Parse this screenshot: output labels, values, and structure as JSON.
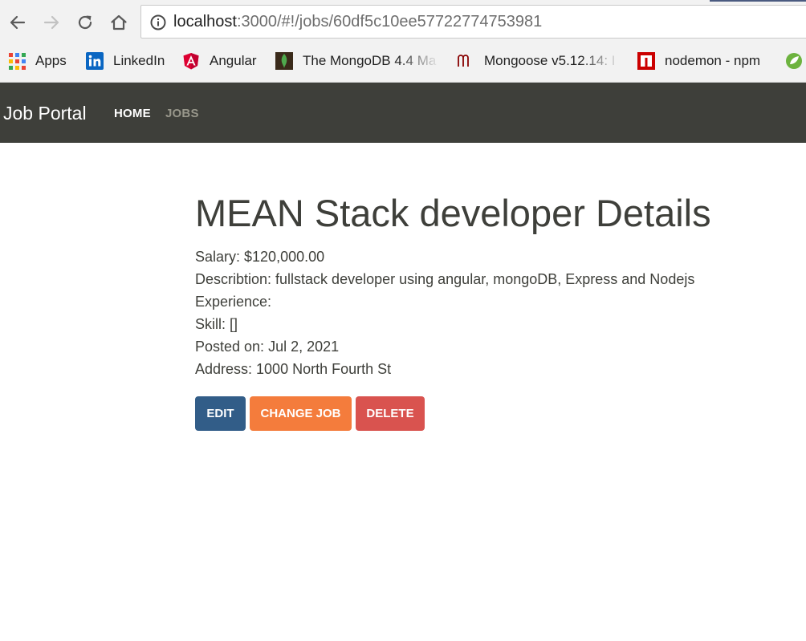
{
  "browser": {
    "url_host": "localhost",
    "url_rest": ":3000/#!/jobs/60df5c10ee57722774753981"
  },
  "bookmarks": [
    {
      "label": "Apps",
      "icon": "apps-grid-icon"
    },
    {
      "label": "LinkedIn",
      "icon": "linkedin-icon"
    },
    {
      "label": "Angular",
      "icon": "angular-icon"
    },
    {
      "label": "The MongoDB 4.4 Ma",
      "icon": "mongodb-icon"
    },
    {
      "label": "Mongoose v5.12.14: I",
      "icon": "mongoose-icon"
    },
    {
      "label": "nodemon - npm",
      "icon": "npm-icon"
    }
  ],
  "navbar": {
    "brand": "Job Portal",
    "links": [
      "HOME",
      "JOBS"
    ]
  },
  "job": {
    "title": "MEAN Stack developer Details",
    "salary": "Salary: $120,000.00",
    "description": "Describtion: fullstack developer using angular, mongoDB, Express and Nodejs",
    "experience": "Experience:",
    "skill": "Skill: []",
    "posted_on": "Posted on: Jul 2, 2021",
    "address": "Address: 1000 North Fourth St"
  },
  "actions": {
    "edit": "EDIT",
    "change": "CHANGE JOB",
    "delete": "DELETE"
  },
  "colors": {
    "navbar_bg": "#3e3f3a",
    "edit_btn": "#325d88",
    "change_btn": "#f47c3c",
    "delete_btn": "#d9534f"
  }
}
